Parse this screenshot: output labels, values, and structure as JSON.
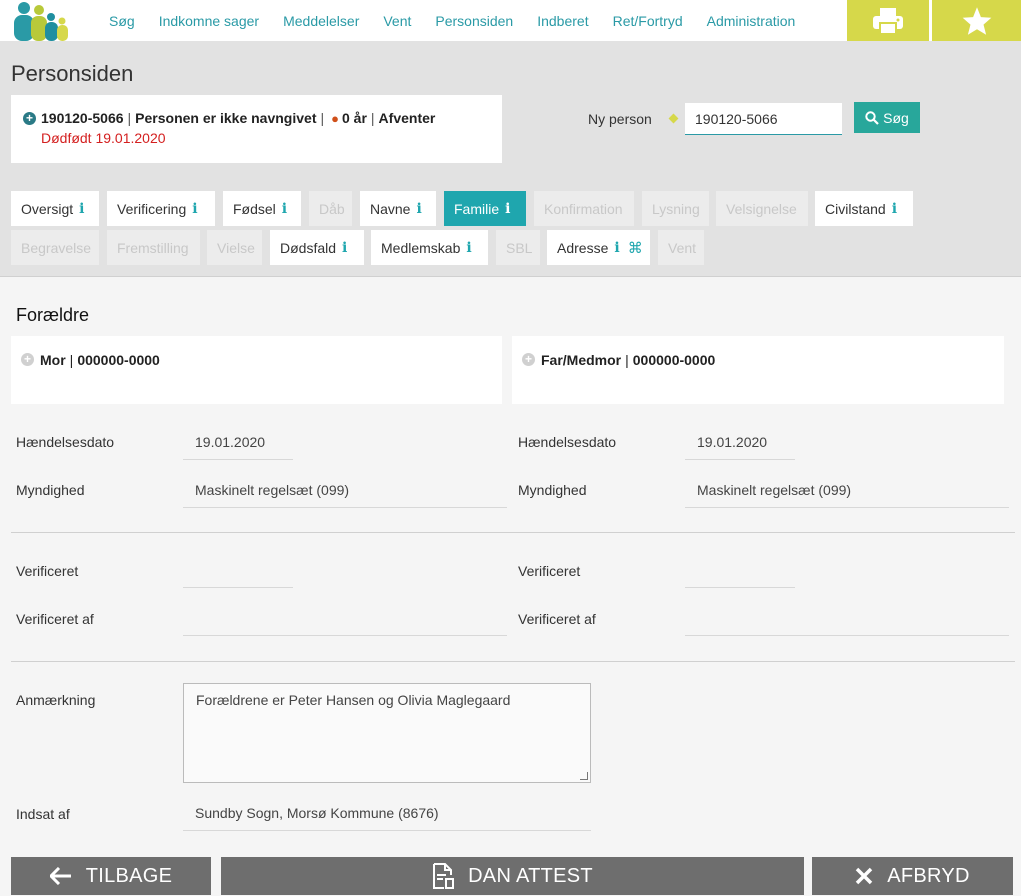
{
  "nav": {
    "items": [
      "Søg",
      "Indkomne sager",
      "Meddelelser",
      "Vent",
      "Personsiden",
      "Indberet",
      "Ret/Fortryd",
      "Administration"
    ],
    "print_icon": "printer-icon",
    "star_icon": "star-icon"
  },
  "page": {
    "title": "Personsiden"
  },
  "person": {
    "cpr": "190120-5066",
    "name": "Personen er ikke navngivet",
    "age": "0 år",
    "status": "Afventer",
    "stillborn": "Dødfødt 19.01.2020"
  },
  "search": {
    "label": "Ny person",
    "value": "190120-5066",
    "button_label": "Søg"
  },
  "tabs": [
    {
      "label": "Oversigt",
      "state": "enabled",
      "info": true
    },
    {
      "label": "Verificering",
      "state": "enabled",
      "info": true
    },
    {
      "label": "Fødsel",
      "state": "enabled",
      "info": true
    },
    {
      "label": "Dåb",
      "state": "disabled",
      "info": false
    },
    {
      "label": "Navne",
      "state": "enabled",
      "info": true
    },
    {
      "label": "Familie",
      "state": "active",
      "info": true
    },
    {
      "label": "Konfirmation",
      "state": "disabled",
      "info": false
    },
    {
      "label": "Lysning",
      "state": "disabled",
      "info": false
    },
    {
      "label": "Velsignelse",
      "state": "disabled",
      "info": false
    },
    {
      "label": "Civilstand",
      "state": "enabled",
      "info": true
    },
    {
      "label": "Begravelse",
      "state": "disabled",
      "info": false
    },
    {
      "label": "Fremstilling",
      "state": "disabled",
      "info": false
    },
    {
      "label": "Vielse",
      "state": "disabled",
      "info": false
    },
    {
      "label": "Dødsfald",
      "state": "enabled",
      "info": true
    },
    {
      "label": "Medlemskab",
      "state": "enabled",
      "info": true
    },
    {
      "label": "SBL",
      "state": "disabled",
      "info": false
    },
    {
      "label": "Adresse",
      "state": "enabled",
      "info": true
    },
    {
      "label": "Vent",
      "state": "disabled",
      "info": false
    }
  ],
  "info_glyph": "i",
  "cmd_glyph": "⌘",
  "section": {
    "title": "Forældre"
  },
  "mother": {
    "role": "Mor",
    "cpr": "000000-0000",
    "event_date_label": "Hændelsesdato",
    "event_date": "19.01.2020",
    "authority_label": "Myndighed",
    "authority": "Maskinelt regelsæt (099)",
    "verified_label": "Verificeret",
    "verified": "",
    "verified_by_label": "Verificeret af",
    "verified_by": ""
  },
  "father": {
    "role": "Far/Medmor",
    "cpr": "000000-0000",
    "event_date_label": "Hændelsesdato",
    "event_date": "19.01.2020",
    "authority_label": "Myndighed",
    "authority": "Maskinelt regelsæt (099)",
    "verified_label": "Verificeret",
    "verified": "",
    "verified_by_label": "Verificeret af",
    "verified_by": ""
  },
  "note": {
    "label": "Anmærkning",
    "value": "Forældrene er Peter Hansen og Olivia Maglegaard"
  },
  "inserted_by": {
    "label": "Indsat af",
    "value": "Sundby Sogn, Morsø Kommune (8676)"
  },
  "buttons": {
    "back": "TILBAGE",
    "certificate": "DAN ATTEST",
    "cancel": "AFBRYD"
  },
  "colors": {
    "accent": "#1fa6ae",
    "top_button": "#d6d84a",
    "header_bg": "#e2e2e2",
    "stillborn": "#d42020",
    "bottom_button": "#6e6e6e"
  }
}
